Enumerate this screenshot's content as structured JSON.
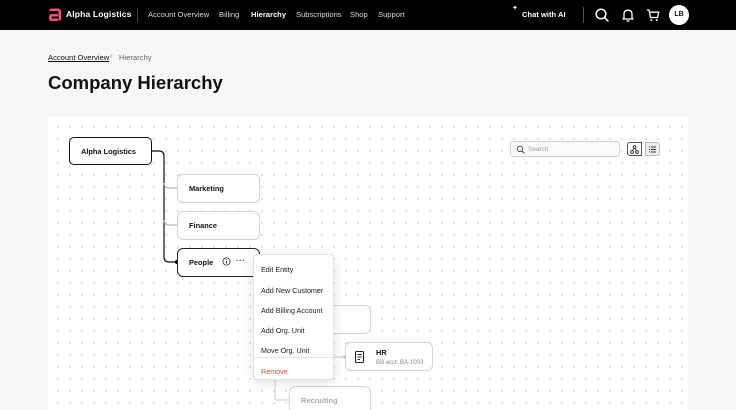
{
  "brand": {
    "name": "Alpha Logistics",
    "color": "#e8537a"
  },
  "nav": {
    "items": [
      {
        "label": "Account Overview",
        "active": false
      },
      {
        "label": "Billing",
        "active": false
      },
      {
        "label": "Hierarchy",
        "active": true
      },
      {
        "label": "Subscriptions",
        "active": false
      },
      {
        "label": "Shop",
        "active": false
      },
      {
        "label": "Support",
        "active": false
      }
    ],
    "chat_label": "Chat with AI",
    "icons": [
      "search-icon",
      "bell-icon",
      "cart-icon"
    ],
    "avatar_initials": "LB"
  },
  "breadcrumb": {
    "parent": "Account Overview",
    "current": "Hierarchy"
  },
  "page": {
    "title": "Company Hierarchy"
  },
  "hierarchy": {
    "root": "Alpha Logistics",
    "children": [
      "Marketing",
      "Finance",
      "People"
    ],
    "people_children": {
      "hr": {
        "name": "HR",
        "billing": "Bill acct: BA-1003"
      },
      "recruiting": "Recruiting"
    }
  },
  "toolbar": {
    "search_placeholder": "Search",
    "views": [
      "tree-view-icon",
      "list-view-icon"
    ]
  },
  "context_menu": {
    "items": [
      "Edit Entity",
      "Add New Customer",
      "Add Billing Account",
      "Add Org. Unit",
      "Move Org. Unit"
    ],
    "danger_item": "Remove",
    "danger_color": "#d0543e"
  }
}
